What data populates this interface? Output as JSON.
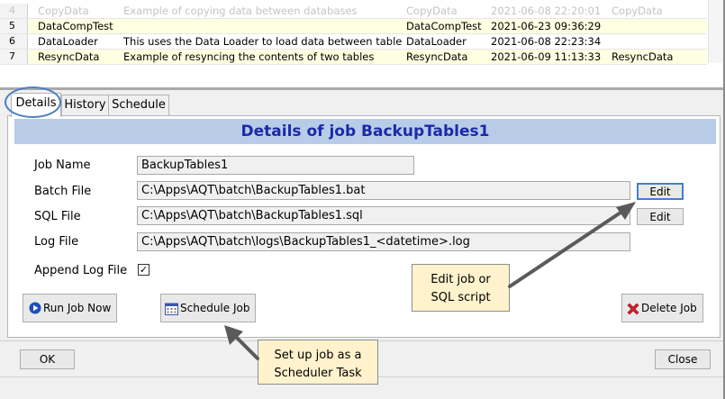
{
  "grid": {
    "rows": [
      {
        "num": "4",
        "name": "CopyData",
        "desc": "Example of copying data between databases",
        "group": "CopyData",
        "date": "2021-06-08 22:20:01",
        "extra": "CopyData",
        "style": "faded"
      },
      {
        "num": "5",
        "name": "DataCompTest",
        "desc": "",
        "group": "DataCompTest",
        "date": "2021-06-23 09:36:29",
        "extra": "",
        "style": "yellow"
      },
      {
        "num": "6",
        "name": "DataLoader",
        "desc": "This uses the Data Loader to load data between tables",
        "group": "DataLoader",
        "date": "2021-06-08 22:23:34",
        "extra": "",
        "style": "white"
      },
      {
        "num": "7",
        "name": "ResyncData",
        "desc": "Example of resyncing the contents of two tables",
        "group": "ResyncData",
        "date": "2021-06-09 11:13:33",
        "extra": "ResyncData",
        "style": "yellow"
      }
    ]
  },
  "tabs": {
    "details": "Details",
    "history": "History",
    "schedule": "Schedule"
  },
  "details": {
    "title": "Details of job BackupTables1",
    "job_name_label": "Job Name",
    "job_name": "BackupTables1",
    "batch_file_label": "Batch File",
    "batch_file": "C:\\Apps\\AQT\\batch\\BackupTables1.bat",
    "sql_file_label": "SQL File",
    "sql_file": "C:\\Apps\\AQT\\batch\\BackupTables1.sql",
    "log_file_label": "Log File",
    "log_file": "C:\\Apps\\AQT\\batch\\logs\\BackupTables1_<datetime>.log",
    "append_log_label": "Append Log File",
    "append_log_check": "✓",
    "edit_batch": "Edit",
    "edit_sql": "Edit",
    "run_job": "Run Job Now",
    "schedule_job": "Schedule Job",
    "delete_job": "Delete Job"
  },
  "footer": {
    "ok": "OK",
    "close": "Close"
  },
  "callouts": {
    "edit_line1": "Edit job or",
    "edit_line2": "SQL script",
    "schedule_line1": "Set up job as a",
    "schedule_line2": "Scheduler Task"
  },
  "colors": {
    "title_bg": "#b8cce8",
    "title_text": "#1b2aa8",
    "callout_bg": "#fff2cc",
    "row_highlight": "#ffffe1",
    "ring": "#4b7fc2",
    "arrow": "#5a5a5a"
  }
}
